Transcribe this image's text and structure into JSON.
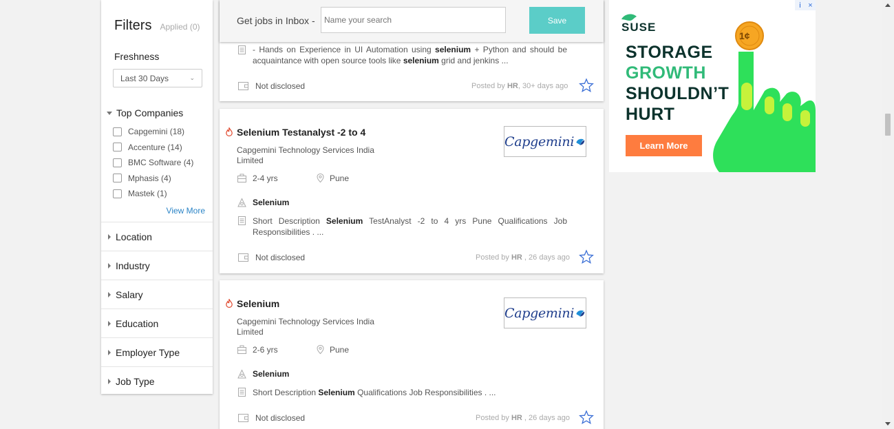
{
  "filters": {
    "title": "Filters",
    "applied": "Applied (0)",
    "freshness_label": "Freshness",
    "freshness_value": "Last 30 Days",
    "top_companies_label": "Top Companies",
    "companies": [
      {
        "label": "Capgemini (18)"
      },
      {
        "label": "Accenture (14)"
      },
      {
        "label": "BMC Software (4)"
      },
      {
        "label": "Mphasis (4)"
      },
      {
        "label": "Mastek (1)"
      }
    ],
    "view_more": "View More",
    "facets": [
      "Location",
      "Industry",
      "Salary",
      "Education",
      "Employer Type",
      "Job Type"
    ]
  },
  "inbox": {
    "label": "Get jobs in Inbox -",
    "placeholder": "Name your search",
    "save": "Save"
  },
  "job0": {
    "desc_pre": "- Hands on Experience in UI Automation using ",
    "desc_b1": "selenium",
    "desc_mid": " + Python and should be acquaintance with open source tools like ",
    "desc_b2": "selenium",
    "desc_post": " grid and jenkins ...",
    "salary": "Not disclosed",
    "posted_pre": "Posted by ",
    "posted_by": "HR",
    "posted_post": ", 30+ days ago"
  },
  "job1": {
    "title": "Selenium Testanalyst -2 to 4",
    "company": "Capgemini Technology Services India Limited",
    "logo": "Capgemini",
    "experience": "2-4 yrs",
    "location": "Pune",
    "skill": "Selenium",
    "desc_pre": "Short Description ",
    "desc_b1": "Selenium",
    "desc_post": " TestAnalyst -2 to 4 yrs Pune Qualifications Job Responsibilities . ...",
    "salary": "Not disclosed",
    "posted_pre": "Posted by ",
    "posted_by": "HR",
    "posted_post": " , 26 days ago"
  },
  "job2": {
    "title": "Selenium",
    "company": "Capgemini Technology Services India Limited",
    "logo": "Capgemini",
    "experience": "2-6 yrs",
    "location": "Pune",
    "skill": "Selenium",
    "desc_pre": "Short Description ",
    "desc_b1": "Selenium",
    "desc_post": " Qualifications Job Responsibilities . ...",
    "salary": "Not disclosed",
    "posted_pre": "Posted by ",
    "posted_by": "HR",
    "posted_post": " , 26 days ago"
  },
  "ad": {
    "brand": "SUSE",
    "line1": "STORAGE",
    "line2": "GROWTH",
    "line3": "SHOULDN’T",
    "line4": "HURT",
    "coin": "1¢",
    "cta": "Learn More",
    "info": "i",
    "close": "×",
    "colors": {
      "green": "#30ba78",
      "bright_green": "#2ee05a",
      "navy": "#0c322c",
      "orange": "#fe7c3f"
    }
  },
  "colors": {
    "accent": "#5bcdc8",
    "link": "#2b84c6",
    "star": "#3b6fd6",
    "flame": "#e0452a"
  }
}
